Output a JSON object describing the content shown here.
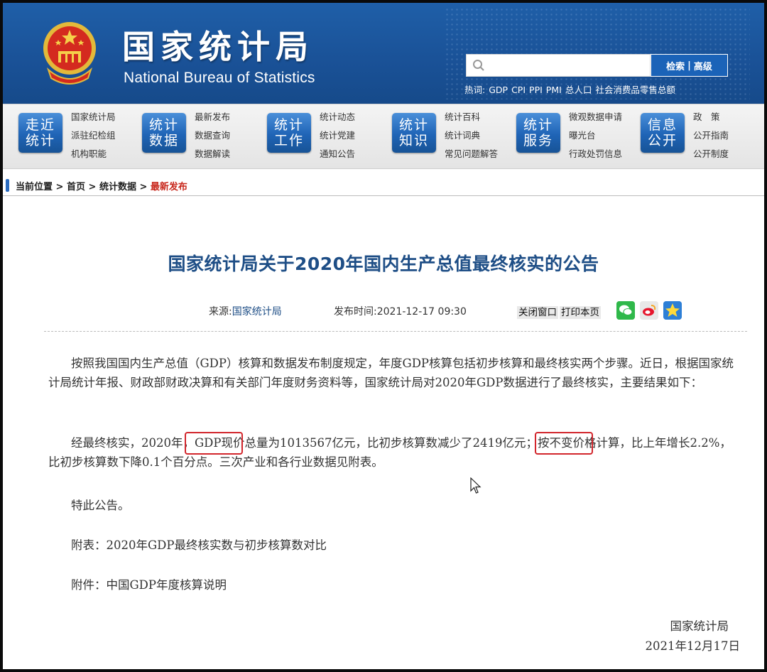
{
  "header": {
    "title_cn": "国家统计局",
    "title_en": "National Bureau of Statistics",
    "search": {
      "placeholder": "",
      "button_search": "检索",
      "separator": "|",
      "button_advanced": "高级"
    },
    "hot_label": "热词:",
    "hot_terms": [
      "GDP",
      "CPI",
      "PPI",
      "PMI",
      "总人口",
      "社会消费品零售总额"
    ]
  },
  "nav": [
    {
      "button": [
        "走近",
        "统计"
      ],
      "links": [
        "国家统计局",
        "派驻纪检组",
        "机构职能"
      ]
    },
    {
      "button": [
        "统计",
        "数据"
      ],
      "links": [
        "最新发布",
        "数据查询",
        "数据解读"
      ]
    },
    {
      "button": [
        "统计",
        "工作"
      ],
      "links": [
        "统计动态",
        "统计党建",
        "通知公告"
      ]
    },
    {
      "button": [
        "统计",
        "知识"
      ],
      "links": [
        "统计百科",
        "统计词典",
        "常见问题解答"
      ]
    },
    {
      "button": [
        "统计",
        "服务"
      ],
      "links": [
        "微观数据申请",
        "曝光台",
        "行政处罚信息"
      ]
    },
    {
      "button": [
        "信息",
        "公开"
      ],
      "links": [
        "政　策",
        "公开指南",
        "公开制度"
      ]
    }
  ],
  "breadcrumb": {
    "prefix": "当前位置",
    "sep": " > ",
    "items": [
      "首页",
      "统计数据"
    ],
    "current": "最新发布"
  },
  "article": {
    "title": "国家统计局关于2020年国内生产总值最终核实的公告",
    "source_label": "来源:",
    "source_value": "国家统计局",
    "time_label": "发布时间:",
    "time_value": "2021-12-17 09:30",
    "close_window": "关闭窗口",
    "print_page": "打印本页",
    "paragraphs": [
      "按照我国国内生产总值（GDP）核算和数据发布制度规定，年度GDP核算包括初步核算和最终核实两个步骤。近日，根据国家统计局统计年报、财政部财政决算和有关部门年度财务资料等，国家统计局对2020年GDP数据进行了最终核实，主要结果如下：",
      "经最终核实，2020年，GDP现价总量为1013567亿元，比初步核算数减少了2419亿元；按不变价格计算，比上年增长2.2%，比初步核算数下降0.1个百分点。三次产业和各行业数据见附表。",
      "特此公告。",
      "附表：2020年GDP最终核实数与初步核算数对比",
      "附件：中国GDP年度核算说明"
    ],
    "signature_org": "国家统计局",
    "signature_date": "2021年12月17日"
  },
  "colors": {
    "header_blue": "#1a5298",
    "title_blue": "#1e4e86",
    "highlight_red": "#d2262c",
    "breadcrumb_current": "#c8271c"
  },
  "icons": [
    "search-icon",
    "wechat-icon",
    "weibo-icon",
    "favorite-star-icon",
    "mouse-cursor-icon",
    "national-emblem-icon"
  ]
}
